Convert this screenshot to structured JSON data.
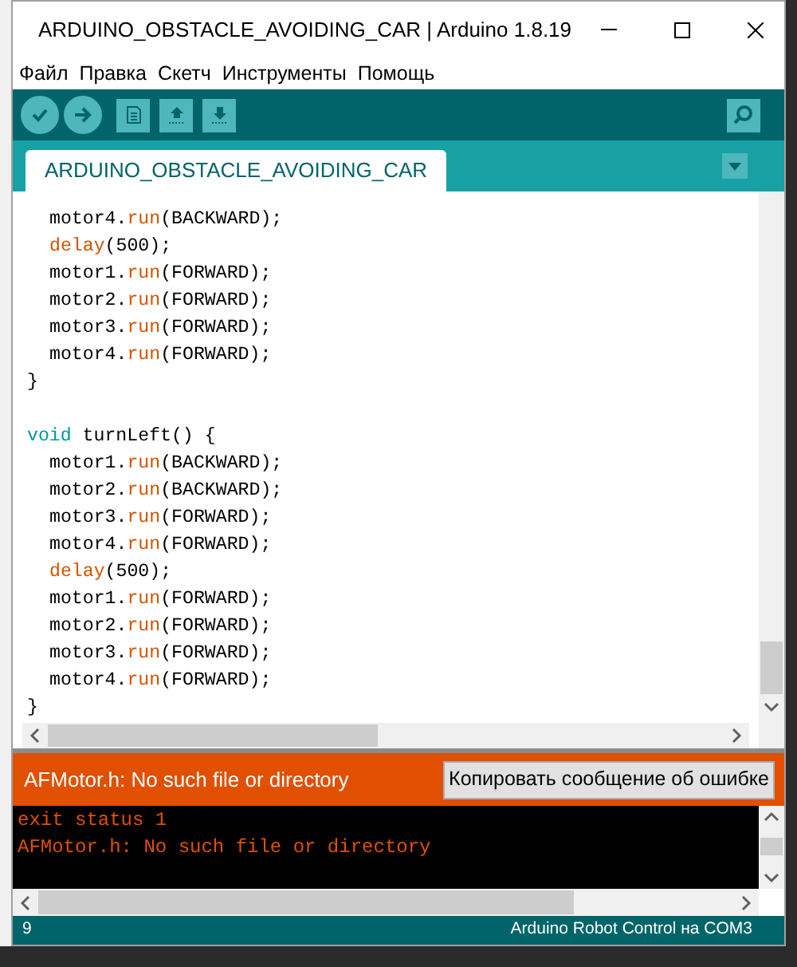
{
  "window": {
    "title": "ARDUINO_OBSTACLE_AVOIDING_CAR | Arduino 1.8.19"
  },
  "menu": [
    "Файл",
    "Правка",
    "Скетч",
    "Инструменты",
    "Помощь"
  ],
  "tabs": [
    {
      "label": "ARDUINO_OBSTACLE_AVOIDING_CAR",
      "selected": true
    }
  ],
  "editor": {
    "lines": [
      {
        "kind": "code",
        "indent": true,
        "segments": [
          {
            "kind": "plain",
            "text": "motor4."
          },
          {
            "kind": "function",
            "text": "run"
          },
          {
            "kind": "plain",
            "text": "(BACKWARD);"
          }
        ]
      },
      {
        "kind": "code",
        "indent": true,
        "segments": [
          {
            "kind": "function",
            "text": "delay"
          },
          {
            "kind": "plain",
            "text": "(500);"
          }
        ]
      },
      {
        "kind": "code",
        "indent": true,
        "segments": [
          {
            "kind": "plain",
            "text": "motor1."
          },
          {
            "kind": "function",
            "text": "run"
          },
          {
            "kind": "plain",
            "text": "(FORWARD);"
          }
        ]
      },
      {
        "kind": "code",
        "indent": true,
        "segments": [
          {
            "kind": "plain",
            "text": "motor2."
          },
          {
            "kind": "function",
            "text": "run"
          },
          {
            "kind": "plain",
            "text": "(FORWARD);"
          }
        ]
      },
      {
        "kind": "code",
        "indent": true,
        "segments": [
          {
            "kind": "plain",
            "text": "motor3."
          },
          {
            "kind": "function",
            "text": "run"
          },
          {
            "kind": "plain",
            "text": "(FORWARD);"
          }
        ]
      },
      {
        "kind": "code",
        "indent": true,
        "segments": [
          {
            "kind": "plain",
            "text": "motor4."
          },
          {
            "kind": "function",
            "text": "run"
          },
          {
            "kind": "plain",
            "text": "(FORWARD);"
          }
        ]
      },
      {
        "kind": "code",
        "indent": false,
        "segments": [
          {
            "kind": "plain",
            "text": "}"
          }
        ]
      },
      {
        "kind": "blank"
      },
      {
        "kind": "code",
        "indent": false,
        "segments": [
          {
            "kind": "keyword",
            "text": "void"
          },
          {
            "kind": "plain",
            "text": " turnLeft() {"
          }
        ]
      },
      {
        "kind": "code",
        "indent": true,
        "segments": [
          {
            "kind": "plain",
            "text": "motor1."
          },
          {
            "kind": "function",
            "text": "run"
          },
          {
            "kind": "plain",
            "text": "(BACKWARD);"
          }
        ]
      },
      {
        "kind": "code",
        "indent": true,
        "segments": [
          {
            "kind": "plain",
            "text": "motor2."
          },
          {
            "kind": "function",
            "text": "run"
          },
          {
            "kind": "plain",
            "text": "(BACKWARD);"
          }
        ]
      },
      {
        "kind": "code",
        "indent": true,
        "segments": [
          {
            "kind": "plain",
            "text": "motor3."
          },
          {
            "kind": "function",
            "text": "run"
          },
          {
            "kind": "plain",
            "text": "(FORWARD);"
          }
        ]
      },
      {
        "kind": "code",
        "indent": true,
        "segments": [
          {
            "kind": "plain",
            "text": "motor4."
          },
          {
            "kind": "function",
            "text": "run"
          },
          {
            "kind": "plain",
            "text": "(FORWARD);"
          }
        ]
      },
      {
        "kind": "code",
        "indent": true,
        "segments": [
          {
            "kind": "function",
            "text": "delay"
          },
          {
            "kind": "plain",
            "text": "(500);"
          }
        ]
      },
      {
        "kind": "code",
        "indent": true,
        "segments": [
          {
            "kind": "plain",
            "text": "motor1."
          },
          {
            "kind": "function",
            "text": "run"
          },
          {
            "kind": "plain",
            "text": "(FORWARD);"
          }
        ]
      },
      {
        "kind": "code",
        "indent": true,
        "segments": [
          {
            "kind": "plain",
            "text": "motor2."
          },
          {
            "kind": "function",
            "text": "run"
          },
          {
            "kind": "plain",
            "text": "(FORWARD);"
          }
        ]
      },
      {
        "kind": "code",
        "indent": true,
        "segments": [
          {
            "kind": "plain",
            "text": "motor3."
          },
          {
            "kind": "function",
            "text": "run"
          },
          {
            "kind": "plain",
            "text": "(FORWARD);"
          }
        ]
      },
      {
        "kind": "code",
        "indent": true,
        "segments": [
          {
            "kind": "plain",
            "text": "motor4."
          },
          {
            "kind": "function",
            "text": "run"
          },
          {
            "kind": "plain",
            "text": "(FORWARD);"
          }
        ]
      },
      {
        "kind": "code",
        "indent": false,
        "segments": [
          {
            "kind": "plain",
            "text": "}"
          }
        ]
      }
    ]
  },
  "error_bar": {
    "message": "AFMotor.h: No such file or directory",
    "button": "Копировать сообщение об ошибке"
  },
  "console": {
    "lines": [
      "exit status 1",
      "AFMotor.h: No such file or directory"
    ]
  },
  "status_bar": {
    "line": "9",
    "board": "Arduino Robot Control на COM3"
  }
}
